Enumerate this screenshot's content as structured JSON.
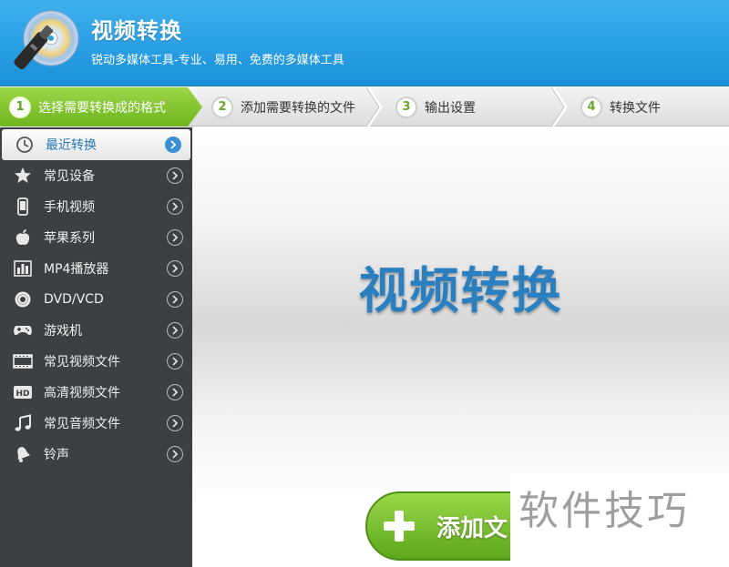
{
  "header": {
    "title": "视频转换",
    "subtitle": "锐动多媒体工具-专业、易用、免费的多媒体工具",
    "logo_icon": "cd-disc-brush-icon"
  },
  "steps": [
    {
      "num": "1",
      "label": "选择需要转换成的格式",
      "active": true
    },
    {
      "num": "2",
      "label": "添加需要转换的文件",
      "active": false
    },
    {
      "num": "3",
      "label": "输出设置",
      "active": false
    },
    {
      "num": "4",
      "label": "转换文件",
      "active": false
    }
  ],
  "sidebar": {
    "items": [
      {
        "label": "最近转换",
        "icon": "clock-icon",
        "active": true
      },
      {
        "label": "常见设备",
        "icon": "star-icon"
      },
      {
        "label": "手机视频",
        "icon": "phone-icon"
      },
      {
        "label": "苹果系列",
        "icon": "apple-icon"
      },
      {
        "label": "MP4播放器",
        "icon": "equalizer-icon"
      },
      {
        "label": "DVD/VCD",
        "icon": "disc-icon"
      },
      {
        "label": "游戏机",
        "icon": "gamepad-icon"
      },
      {
        "label": "常见视频文件",
        "icon": "film-icon"
      },
      {
        "label": "高清视频文件",
        "icon": "hd-icon"
      },
      {
        "label": "常见音频文件",
        "icon": "music-note-icon"
      },
      {
        "label": "铃声",
        "icon": "bell-icon"
      }
    ]
  },
  "main": {
    "title": "视频转换",
    "add_button_label": "添加文",
    "watermark": "软件技巧"
  },
  "colors": {
    "header_blue": "#2a9fe4",
    "step_active_green": "#6db51d",
    "sidebar_bg": "#3c4043",
    "accent_blue": "#2a7fc0"
  }
}
